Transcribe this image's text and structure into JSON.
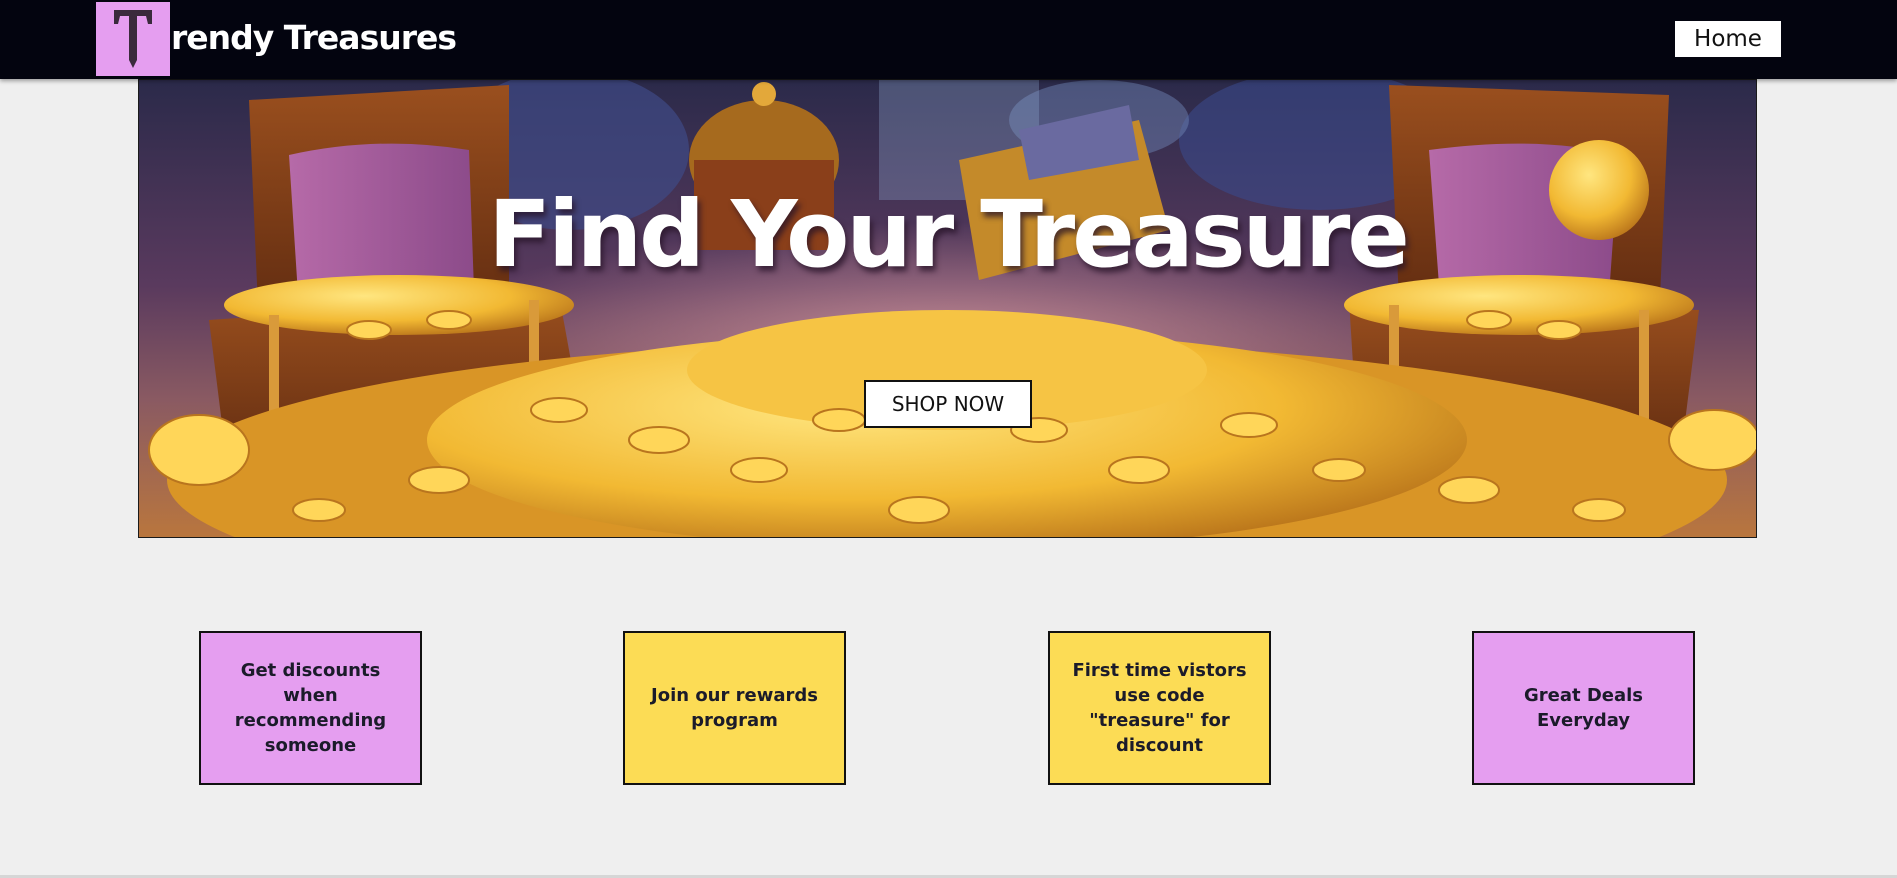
{
  "header": {
    "logo_letter": "T",
    "brand_text": "rendy Treasures",
    "nav_home_label": "Home"
  },
  "hero": {
    "title": "Find Your Treasure",
    "cta_label": "SHOP NOW"
  },
  "promos": [
    {
      "text": "Get discounts when recommending someone",
      "color": "#e59ef0"
    },
    {
      "text": "Join our rewards program",
      "color": "#fcdc55"
    },
    {
      "text": "First time vistors use code \"treasure\" for discount",
      "color": "#fcdc55"
    },
    {
      "text": "Great Deals Everyday",
      "color": "#e59ef0"
    }
  ],
  "colors": {
    "navbar_bg": "#03040f",
    "accent_pink": "#e59ef0",
    "accent_yellow": "#fcdc55",
    "page_bg": "#efefef"
  }
}
